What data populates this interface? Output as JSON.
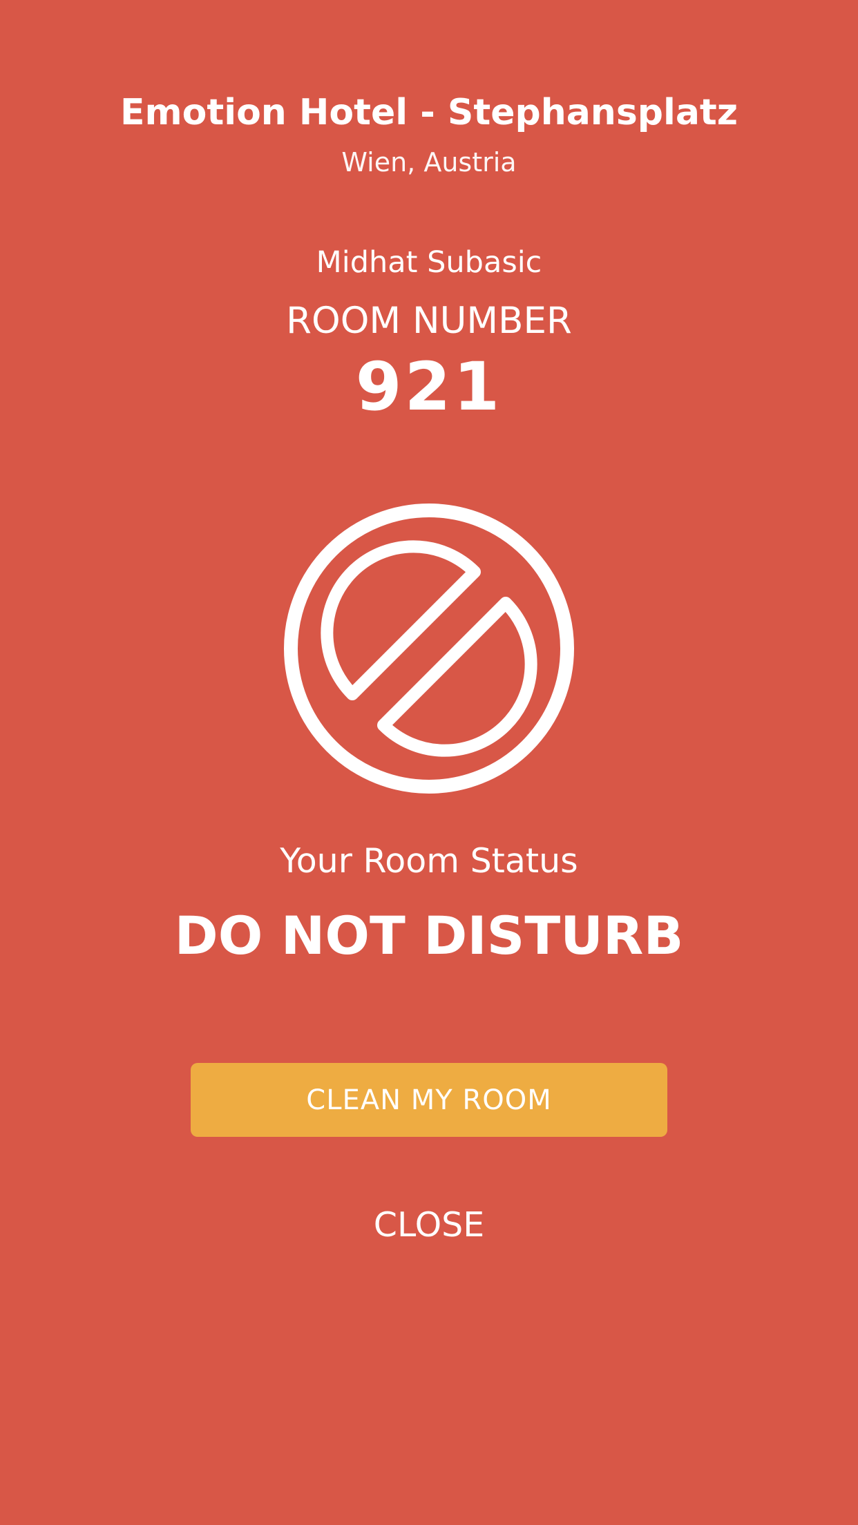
{
  "hotel": {
    "name": "Emotion Hotel - Stephansplatz",
    "location": "Wien, Austria"
  },
  "guest": {
    "name": "Midhat Subasic"
  },
  "room": {
    "label": "ROOM NUMBER",
    "number": "921"
  },
  "status": {
    "label": "Your Room Status",
    "value": "DO NOT DISTURB",
    "icon": "do-not-disturb-icon"
  },
  "actions": {
    "clean_label": "CLEAN MY ROOM",
    "close_label": "CLOSE"
  },
  "colors": {
    "background": "#D85747",
    "button": "#EEAC42",
    "text": "#FFFFFF"
  }
}
